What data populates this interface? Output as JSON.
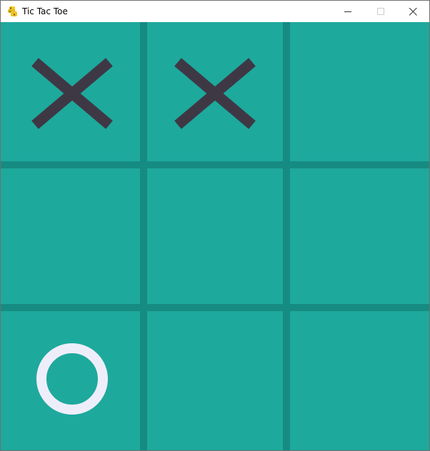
{
  "window": {
    "title": "Tic Tac Toe",
    "app_icon": "python-snake-icon",
    "controls": {
      "minimize_icon": "minimize-icon",
      "maximize_icon": "maximize-icon",
      "close_icon": "close-icon"
    }
  },
  "game": {
    "board": [
      [
        "X",
        "X",
        ""
      ],
      [
        "",
        "",
        ""
      ],
      [
        "O",
        "",
        ""
      ]
    ],
    "colors": {
      "background": "#1ea99d",
      "grid_lines": "#168b82",
      "x_mark": "#3e3845",
      "o_mark": "#eeeefa"
    }
  }
}
